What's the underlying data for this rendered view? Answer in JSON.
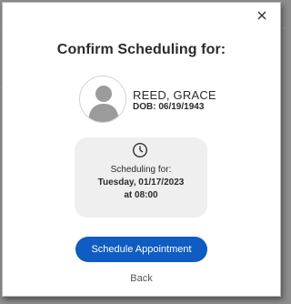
{
  "modal": {
    "title": "Confirm Scheduling for:",
    "close_icon": "close-icon"
  },
  "patient": {
    "name": "REED, GRACE",
    "dob_label": "DOB:",
    "dob_value": "06/19/1943",
    "avatar_icon": "person-silhouette-icon"
  },
  "schedule": {
    "icon": "clock-icon",
    "label": "Scheduling for:",
    "date": "Tuesday, 01/17/2023",
    "time": "at 08:00"
  },
  "actions": {
    "primary_label": "Schedule Appointment",
    "back_label": "Back"
  },
  "colors": {
    "primary": "#0f5cc2",
    "card_bg": "#efefef",
    "backdrop": "#8d8d8d"
  }
}
